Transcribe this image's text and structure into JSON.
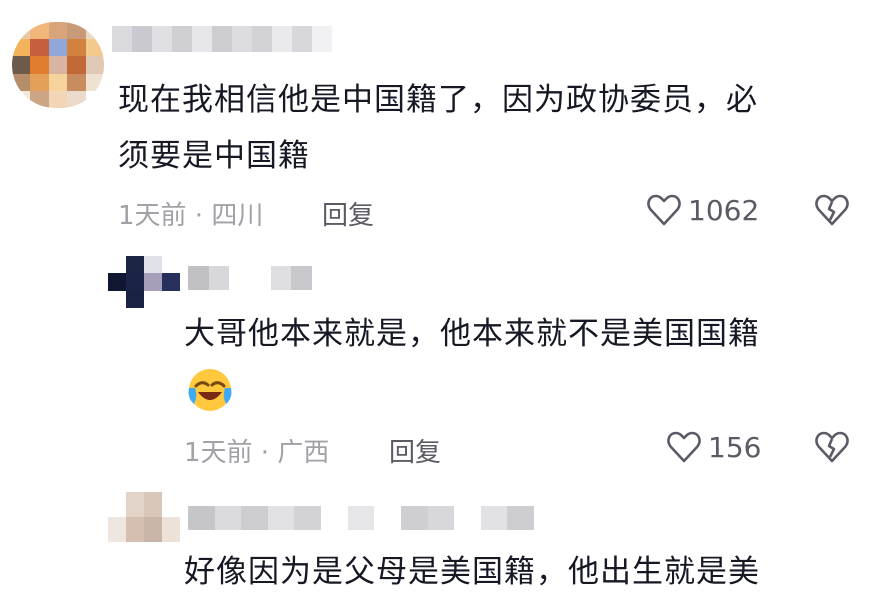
{
  "comments": [
    {
      "text_line1": "现在我相信他是中国籍了，因为政协委员，必",
      "text_line2": "须要是中国籍",
      "time_location": "1天前 · 四川",
      "reply_label": "回复",
      "likes": "1062"
    },
    {
      "text_line1": "大哥他本来就是，他本来就不是美国国籍",
      "emoji": "cry-laugh-emoji",
      "time_location": "1天前 · 广西",
      "reply_label": "回复",
      "likes": "156"
    },
    {
      "text_line1": "好像因为是父母是美国籍，他出生就是美"
    }
  ],
  "icons": {
    "like": "heart-outline-icon",
    "dislike": "broken-heart-icon"
  },
  "colors": {
    "text": "#161823",
    "meta": "#a1a1a7",
    "icon": "#5b5b66"
  }
}
